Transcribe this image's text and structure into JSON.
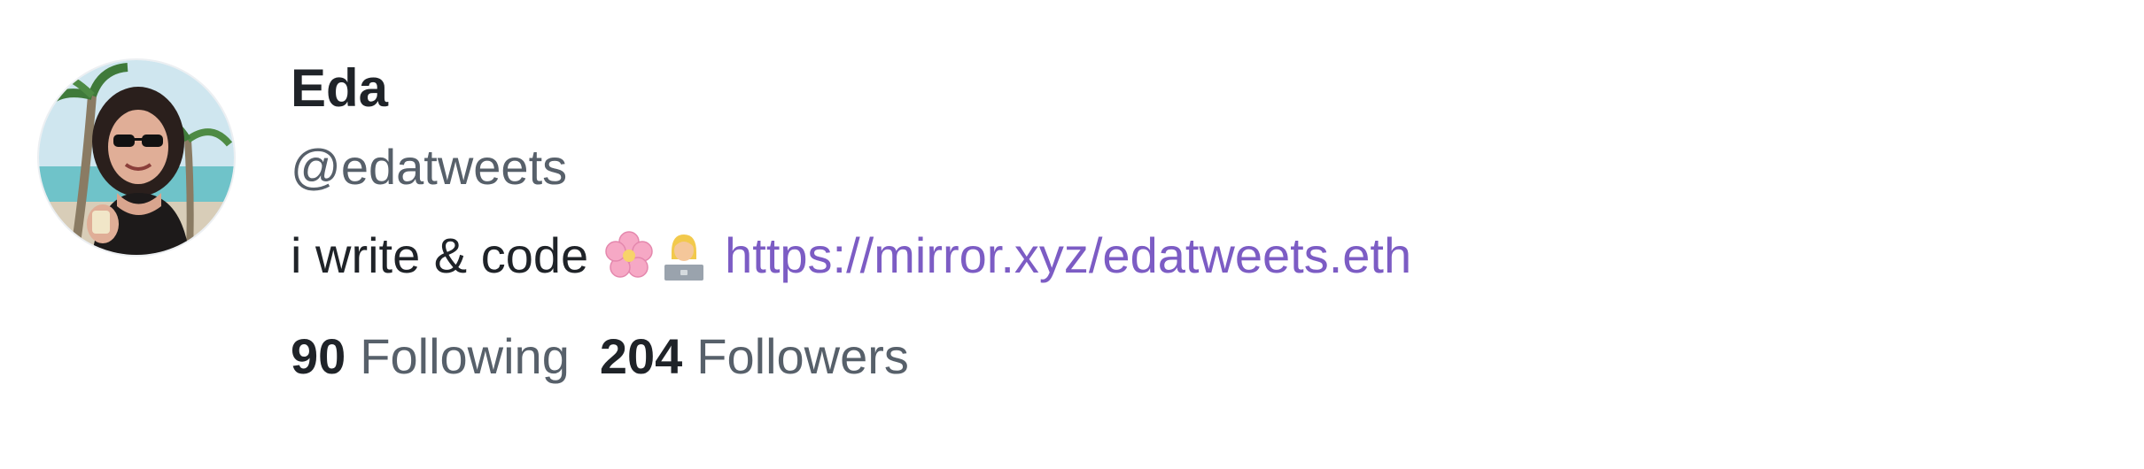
{
  "profile": {
    "display_name": "Eda",
    "handle": "@edatweets",
    "bio": {
      "text": "i write & code",
      "emojis": [
        "cherry-blossom-icon",
        "technologist-icon"
      ],
      "link": "https://mirror.xyz/edatweets.eth"
    },
    "stats": {
      "following_count": "90",
      "following_label": "Following",
      "followers_count": "204",
      "followers_label": "Followers"
    }
  },
  "colors": {
    "link": "#7c5cc4",
    "muted": "#57606a",
    "text": "#1f2328"
  }
}
